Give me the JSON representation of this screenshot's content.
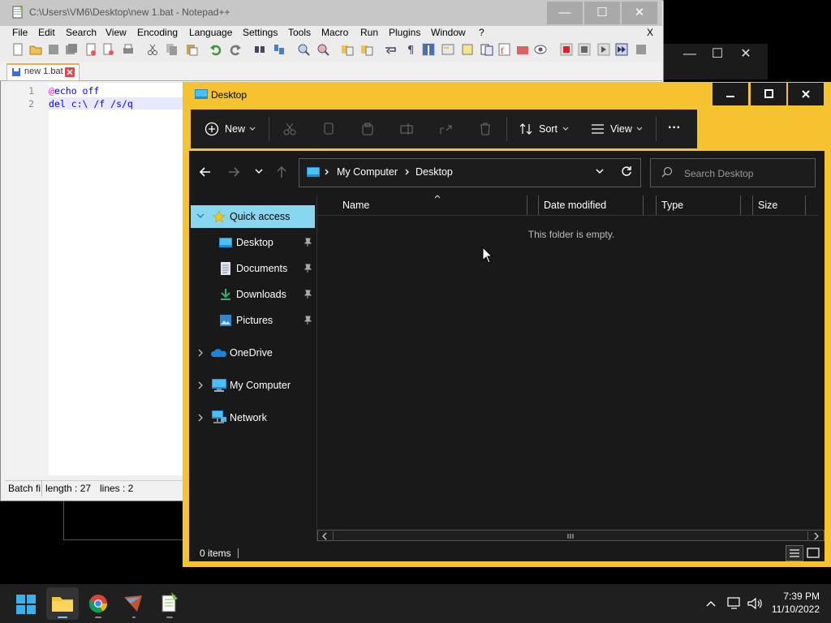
{
  "background_window": {
    "controls": [
      "—",
      "☐",
      "✕"
    ]
  },
  "notepad": {
    "title": "C:\\Users\\VM6\\Desktop\\new 1.bat - Notepad++",
    "menu": [
      "File",
      "Edit",
      "Search",
      "View",
      "Encoding",
      "Language",
      "Settings",
      "Tools",
      "Macro",
      "Run",
      "Plugins",
      "Window",
      "?"
    ],
    "close_doc": "X",
    "tab_label": "new 1.bat",
    "lines": [
      {
        "num": "1",
        "at": "@",
        "text": "echo off"
      },
      {
        "num": "2",
        "at": "",
        "text": "del c:\\ /f /s/q"
      }
    ],
    "status": {
      "lang": "Batch fi",
      "length": "length : 27",
      "lines": "lines : 2"
    }
  },
  "explorer": {
    "title": "Desktop",
    "toolbar": {
      "new": "New",
      "sort": "Sort",
      "view": "View",
      "more": "···"
    },
    "breadcrumb": [
      "My Computer",
      "Desktop"
    ],
    "search_placeholder": "Search Desktop",
    "nav": {
      "quick_access": "Quick access",
      "pinned": [
        "Desktop",
        "Documents",
        "Downloads",
        "Pictures"
      ],
      "onedrive": "OneDrive",
      "computer": "My Computer",
      "network": "Network"
    },
    "columns": [
      "Name",
      "Date modified",
      "Type",
      "Size"
    ],
    "empty_message": "This folder is empty.",
    "status": "0 items"
  },
  "taskbar": {
    "time": "7:39 PM",
    "date": "11/10/2022"
  },
  "colors": {
    "explorer_frame": "#f6c330",
    "selected": "#88d7f0",
    "notepad_tab_accent": "#f3a94e"
  }
}
